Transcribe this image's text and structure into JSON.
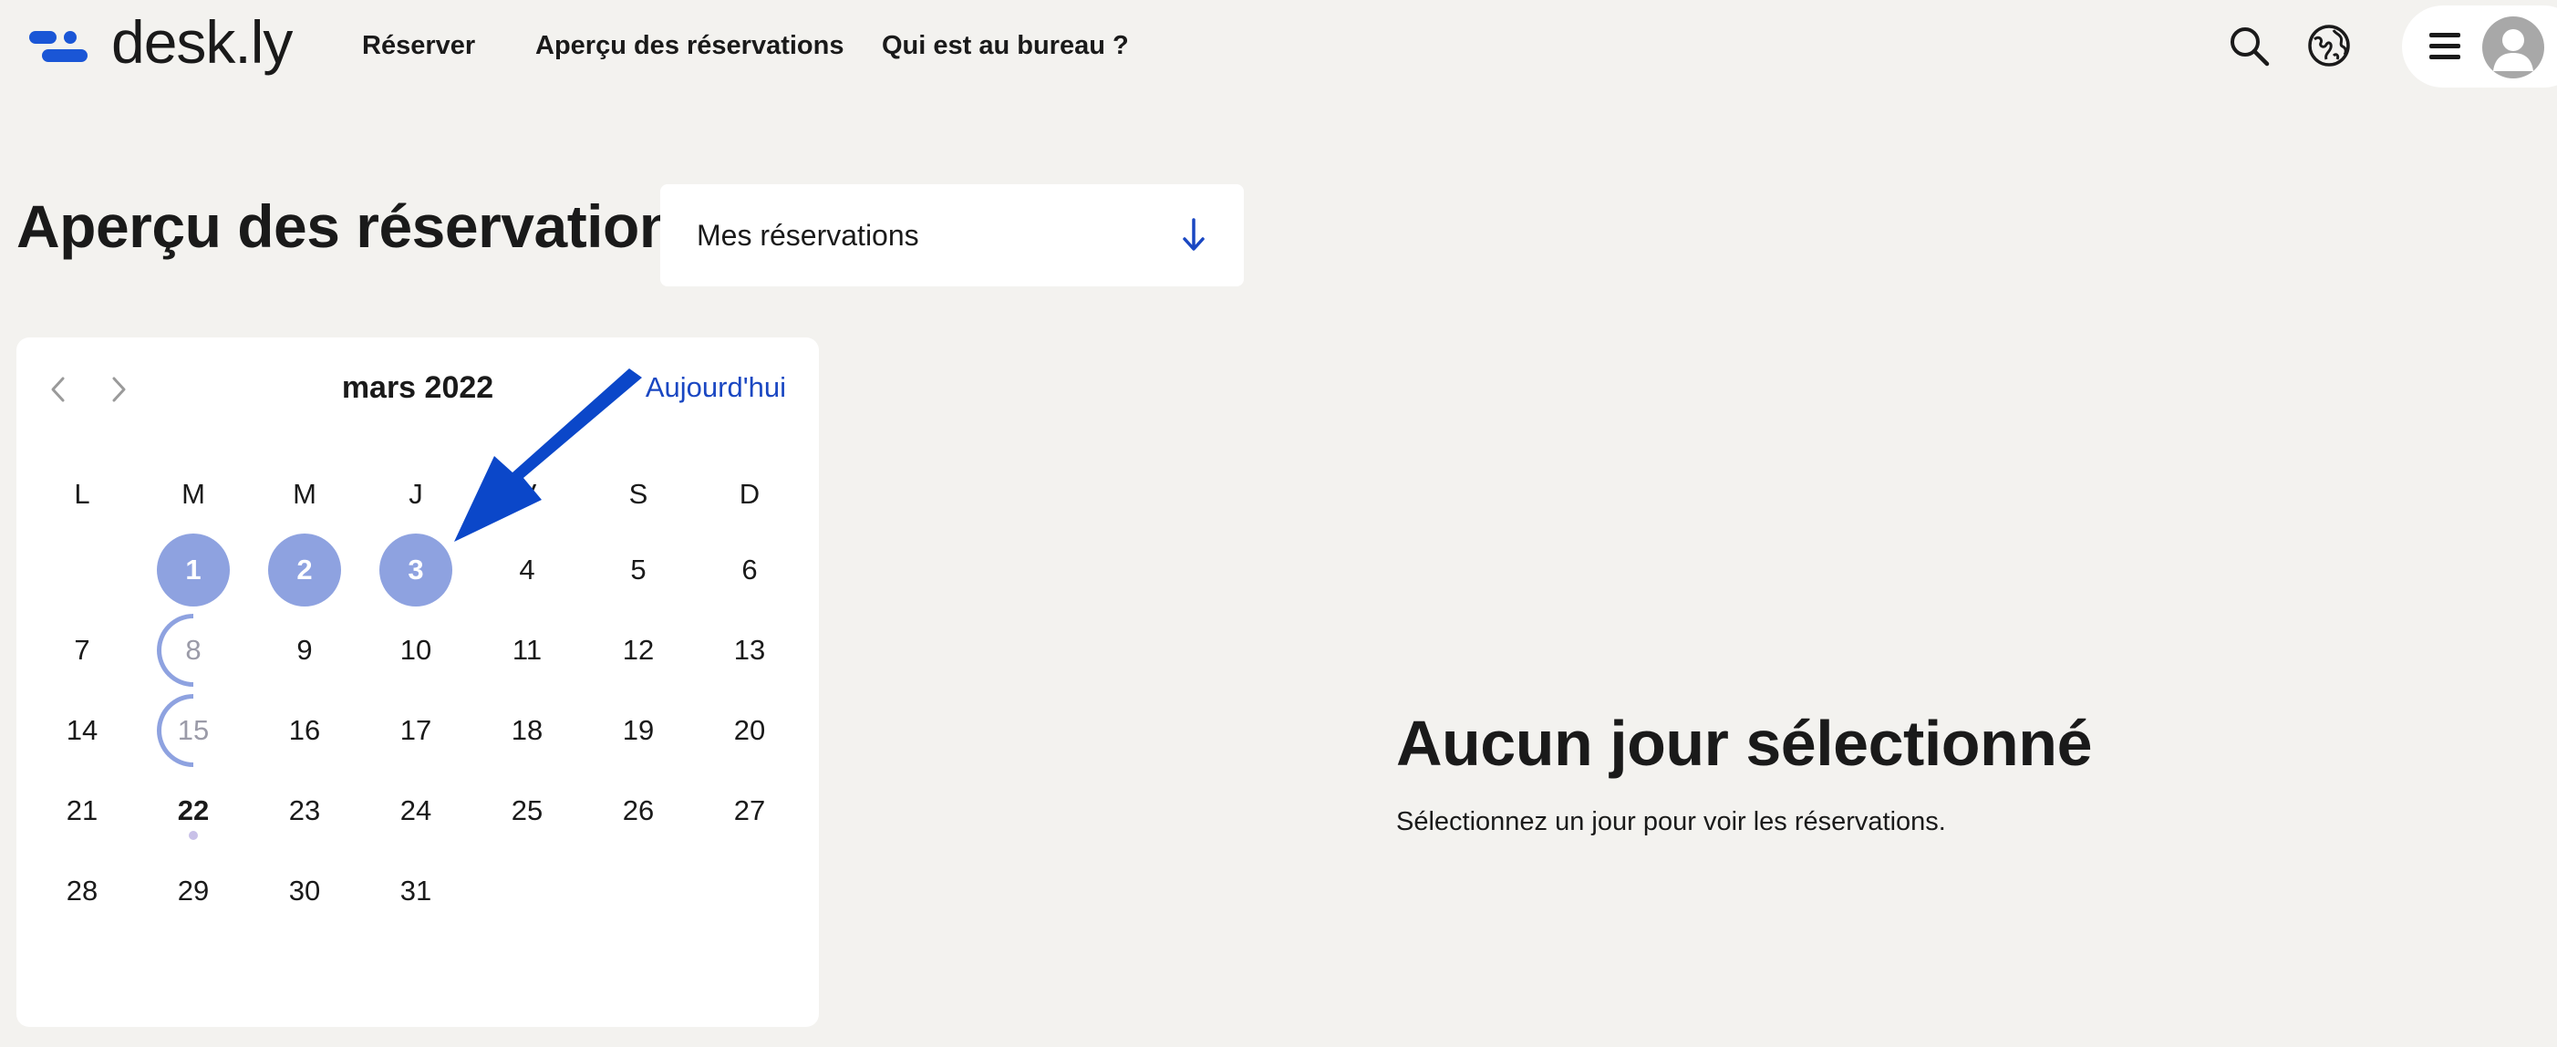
{
  "app": {
    "logo_text": "desk.ly"
  },
  "nav": [
    {
      "label": "Réserver"
    },
    {
      "label": "Aperçu des réservations"
    },
    {
      "label": "Qui est au bureau ?"
    }
  ],
  "header_icons": [
    "search-icon",
    "globe-icon",
    "menu-icon",
    "user-avatar-icon"
  ],
  "page": {
    "title": "Aperçu des réservations",
    "filter": {
      "selected": "Mes réservations",
      "icon": "arrow-down-icon"
    }
  },
  "calendar": {
    "month_label": "mars 2022",
    "today_label": "Aujourd'hui",
    "prev_icon": "chevron-left-icon",
    "next_icon": "chevron-right-icon",
    "weekdays": [
      "L",
      "M",
      "M",
      "J",
      "V",
      "S",
      "D"
    ],
    "days": [
      {
        "n": "1",
        "booked": true
      },
      {
        "n": "2",
        "booked": true
      },
      {
        "n": "3",
        "booked": true
      },
      {
        "n": "4"
      },
      {
        "n": "5"
      },
      {
        "n": "6"
      },
      {
        "n": "7"
      },
      {
        "n": "8",
        "half": true
      },
      {
        "n": "9"
      },
      {
        "n": "10"
      },
      {
        "n": "11"
      },
      {
        "n": "12"
      },
      {
        "n": "13"
      },
      {
        "n": "14"
      },
      {
        "n": "15",
        "half": true
      },
      {
        "n": "16"
      },
      {
        "n": "17"
      },
      {
        "n": "18"
      },
      {
        "n": "19"
      },
      {
        "n": "20"
      },
      {
        "n": "21"
      },
      {
        "n": "22",
        "today": true
      },
      {
        "n": "23"
      },
      {
        "n": "24"
      },
      {
        "n": "25"
      },
      {
        "n": "26"
      },
      {
        "n": "27"
      },
      {
        "n": "28"
      },
      {
        "n": "29"
      },
      {
        "n": "30"
      },
      {
        "n": "31"
      }
    ]
  },
  "empty_state": {
    "title": "Aucun jour sélectionné",
    "subtitle": "Sélectionnez un jour pour voir les réservations."
  },
  "colors": {
    "brand": "#1a56d6",
    "booked": "#8ea2e0",
    "link": "#1a47c2",
    "annotation_arrow": "#0b47c9",
    "background": "#f3f2ef"
  }
}
